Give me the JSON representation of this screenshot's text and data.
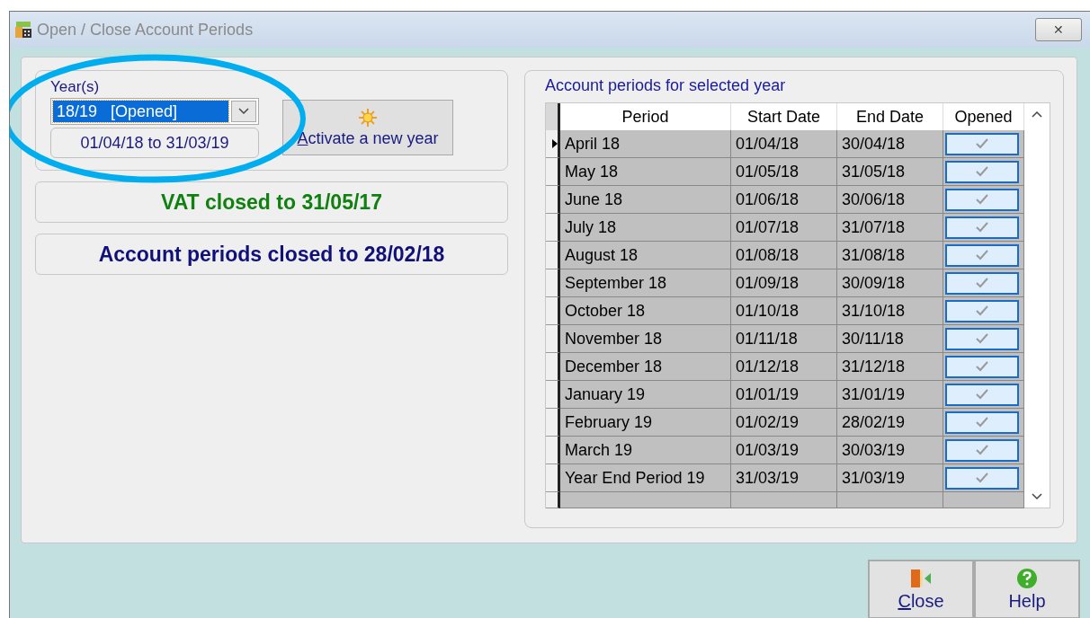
{
  "window": {
    "title": "Open / Close Account Periods",
    "close_glyph": "✕"
  },
  "year_group": {
    "label": "Year(s)",
    "year_value": "18/19   [Opened]",
    "date_range": "01/04/18 to 31/03/19",
    "activate_button": {
      "label": "Activate a new year"
    }
  },
  "vat_status": "VAT closed to 31/05/17",
  "periods_status": "Account periods closed to 28/02/18",
  "periods_panel": {
    "title": "Account periods for selected year",
    "columns": [
      "Period",
      "Start Date",
      "End Date",
      "Opened"
    ],
    "rows": [
      {
        "period": "April 18",
        "start": "01/04/18",
        "end": "30/04/18",
        "opened": true,
        "current": true
      },
      {
        "period": "May 18",
        "start": "01/05/18",
        "end": "31/05/18",
        "opened": true,
        "current": false
      },
      {
        "period": "June 18",
        "start": "01/06/18",
        "end": "30/06/18",
        "opened": true,
        "current": false
      },
      {
        "period": "July 18",
        "start": "01/07/18",
        "end": "31/07/18",
        "opened": true,
        "current": false
      },
      {
        "period": "August 18",
        "start": "01/08/18",
        "end": "31/08/18",
        "opened": true,
        "current": false
      },
      {
        "period": "September 18",
        "start": "01/09/18",
        "end": "30/09/18",
        "opened": true,
        "current": false
      },
      {
        "period": "October 18",
        "start": "01/10/18",
        "end": "31/10/18",
        "opened": true,
        "current": false
      },
      {
        "period": "November 18",
        "start": "01/11/18",
        "end": "30/11/18",
        "opened": true,
        "current": false
      },
      {
        "period": "December 18",
        "start": "01/12/18",
        "end": "31/12/18",
        "opened": true,
        "current": false
      },
      {
        "period": "January 19",
        "start": "01/01/19",
        "end": "31/01/19",
        "opened": true,
        "current": false
      },
      {
        "period": "February 19",
        "start": "01/02/19",
        "end": "28/02/19",
        "opened": true,
        "current": false
      },
      {
        "period": "March 19",
        "start": "01/03/19",
        "end": "30/03/19",
        "opened": true,
        "current": false
      },
      {
        "period": "Year End Period 19",
        "start": "31/03/19",
        "end": "31/03/19",
        "opened": true,
        "current": false
      }
    ]
  },
  "buttons": [
    {
      "kind": "close",
      "label": "Close"
    },
    {
      "kind": "help",
      "label": "Help"
    }
  ]
}
